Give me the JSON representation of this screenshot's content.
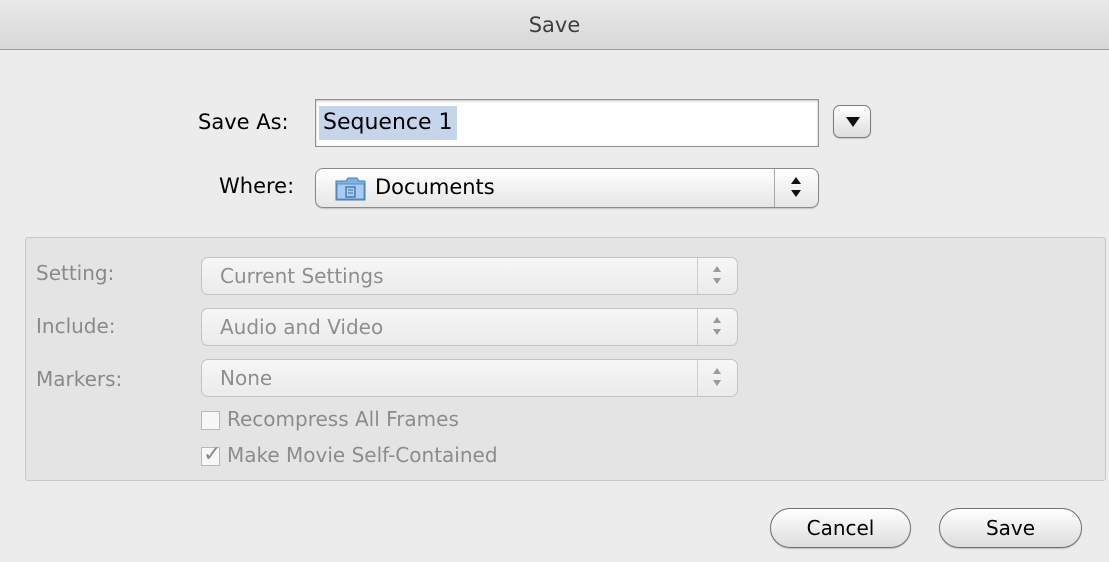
{
  "window": {
    "title": "Save"
  },
  "save_as": {
    "label": "Save As:",
    "value": "Sequence 1"
  },
  "where": {
    "label": "Where:",
    "value": "Documents",
    "icon": "folder-icon"
  },
  "options": {
    "setting": {
      "label": "Setting:",
      "value": "Current Settings"
    },
    "include": {
      "label": "Include:",
      "value": "Audio and Video"
    },
    "markers": {
      "label": "Markers:",
      "value": "None"
    },
    "recompress": {
      "label": "Recompress All Frames",
      "checked": false
    },
    "self_contained": {
      "label": "Make Movie Self-Contained",
      "checked": true
    }
  },
  "buttons": {
    "cancel": "Cancel",
    "save": "Save"
  },
  "colors": {
    "selection": "#c6d5ec",
    "folder": "#5f9bd3"
  }
}
